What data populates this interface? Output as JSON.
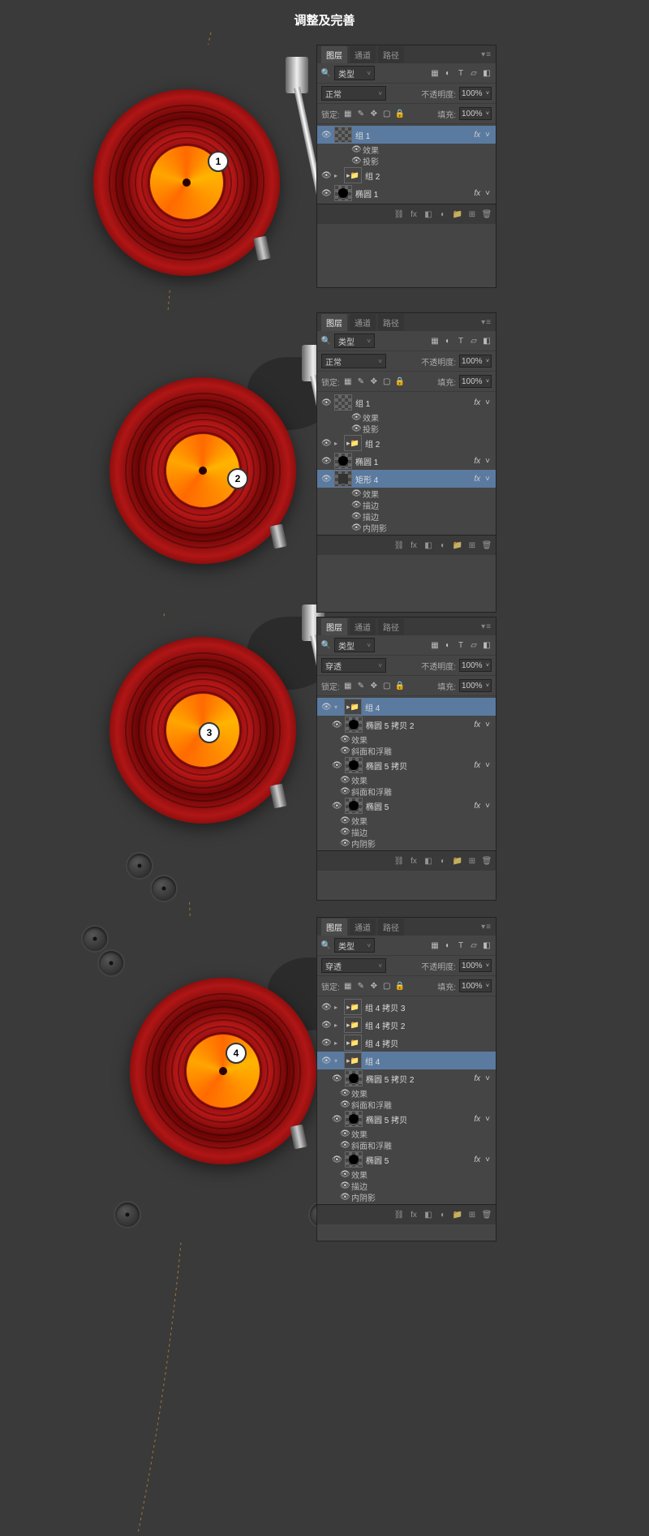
{
  "title": "调整及完善",
  "tabs": {
    "layers": "图层",
    "channels": "通道",
    "paths": "路径"
  },
  "common": {
    "kind": "类型",
    "normal": "正常",
    "passthrough": "穿透",
    "opacity": "不透明度:",
    "fill": "填充:",
    "lock": "锁定:",
    "pct": "100%",
    "effects": "效果",
    "drop_shadow": "投影",
    "stroke": "描边",
    "inner_shadow": "内阴影",
    "bevel": "斜面和浮雕",
    "fx": "fx"
  },
  "steps": [
    {
      "n": "1",
      "blend": "正常",
      "layers": [
        {
          "t": "thumb",
          "name": "组 1",
          "sel": true,
          "fx": true,
          "sub": [
            "效果",
            "投影"
          ]
        },
        {
          "t": "grp",
          "name": "组 2"
        },
        {
          "t": "ell",
          "name": "椭圆 1",
          "fx": true
        }
      ]
    },
    {
      "n": "2",
      "blend": "正常",
      "layers": [
        {
          "t": "thumb",
          "name": "组 1",
          "fx": true,
          "sub": [
            "效果",
            "投影"
          ]
        },
        {
          "t": "grp",
          "name": "组 2"
        },
        {
          "t": "ell",
          "name": "椭圆 1",
          "fx": true
        },
        {
          "t": "rect",
          "name": "矩形 4",
          "sel": true,
          "fx": true,
          "sub": [
            "效果",
            "描边",
            "描边",
            "内阴影"
          ]
        }
      ]
    },
    {
      "n": "3",
      "blend": "穿透",
      "layers": [
        {
          "t": "grp",
          "name": "组 4",
          "open": true,
          "sel": true,
          "children": [
            {
              "t": "ell",
              "name": "椭圆 5 拷贝 2",
              "fx": true,
              "sub": [
                "效果",
                "斜面和浮雕"
              ]
            },
            {
              "t": "ell",
              "name": "椭圆 5 拷贝",
              "fx": true,
              "sub": [
                "效果",
                "斜面和浮雕"
              ]
            },
            {
              "t": "ell",
              "name": "椭圆 5",
              "fx": true,
              "sub": [
                "效果",
                "描边",
                "内阴影"
              ]
            }
          ]
        }
      ]
    },
    {
      "n": "4",
      "blend": "穿透",
      "layers": [
        {
          "t": "grp",
          "name": "组 4 拷贝 3"
        },
        {
          "t": "grp",
          "name": "组 4 拷贝 2"
        },
        {
          "t": "grp",
          "name": "组 4 拷贝"
        },
        {
          "t": "grp",
          "name": "组 4",
          "open": true,
          "sel": true,
          "children": [
            {
              "t": "ell",
              "name": "椭圆 5 拷贝 2",
              "fx": true,
              "sub": [
                "效果",
                "斜面和浮雕"
              ]
            },
            {
              "t": "ell",
              "name": "椭圆 5 拷贝",
              "fx": true,
              "sub": [
                "效果",
                "斜面和浮雕"
              ]
            },
            {
              "t": "ell",
              "name": "椭圆 5",
              "fx": true,
              "sub": [
                "效果",
                "描边",
                "内阴影"
              ]
            }
          ]
        }
      ]
    }
  ]
}
